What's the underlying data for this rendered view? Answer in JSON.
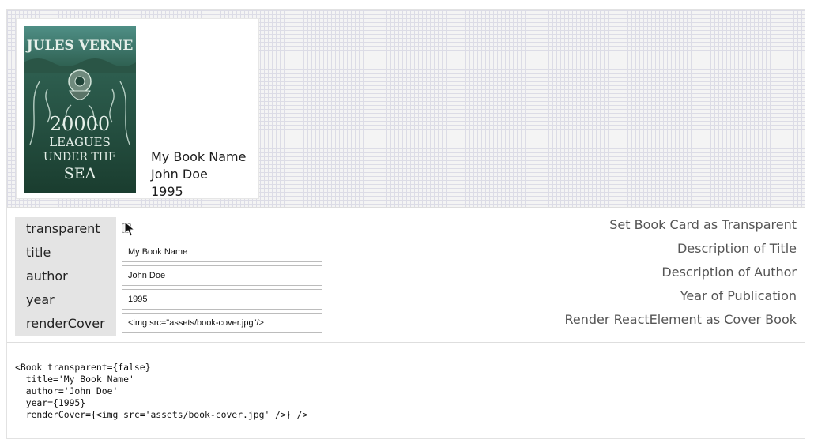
{
  "book": {
    "title": "My Book Name",
    "author": "John Doe",
    "year": "1995",
    "cover_text": {
      "top": "JULES VERNE",
      "line1": "20000",
      "line2": "LEAGUES",
      "line3": "UNDER THE",
      "line4": "SEA"
    }
  },
  "props": [
    {
      "name": "transparent",
      "description": "Set Book Card as Transparent"
    },
    {
      "name": "title",
      "value": "My Book Name",
      "description": "Description of Title"
    },
    {
      "name": "author",
      "value": "John Doe",
      "description": "Description of Author"
    },
    {
      "name": "year",
      "value": "1995",
      "description": "Year of Publication"
    },
    {
      "name": "renderCover",
      "value": "<img src=\"assets/book-cover.jpg\"/>",
      "description": "Render ReactElement as Cover Book"
    }
  ],
  "code": "<Book transparent={false}\n  title='My Book Name'\n  author='John Doe'\n  year={1995}\n  renderCover={<img src='assets/book-cover.jpg' />} />",
  "colors": {
    "cover_bg": "#234a3a",
    "cover_ink": "#dfe9e3"
  },
  "icons": {
    "cursor": "mouse-pointer-icon"
  }
}
